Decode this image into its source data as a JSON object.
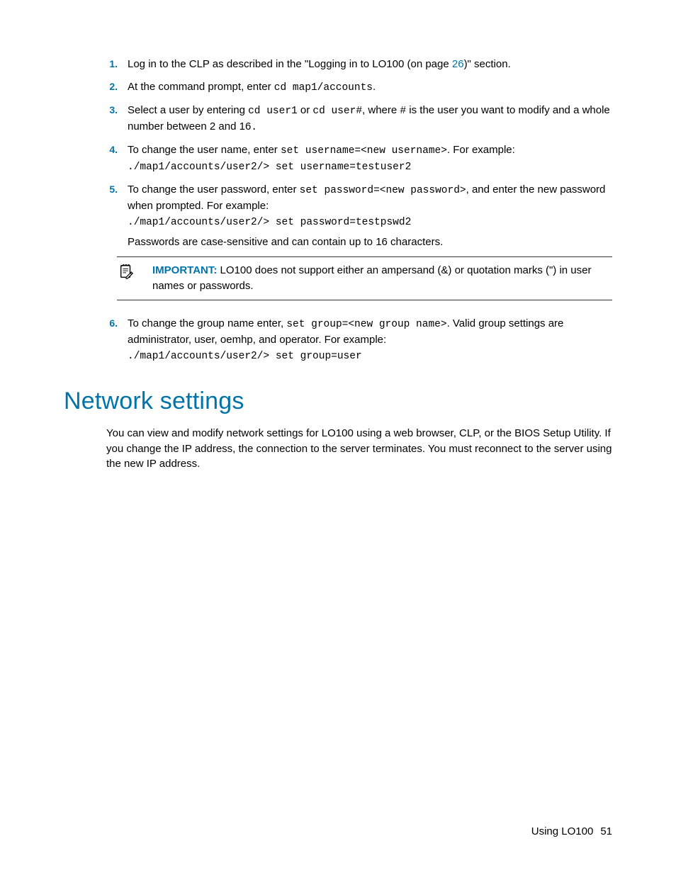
{
  "list": {
    "items": [
      {
        "num": "1.",
        "parts": [
          {
            "t": "Log in to the CLP as described in the \"Logging in to LO100 (on page "
          },
          {
            "t": "26",
            "link": true
          },
          {
            "t": ")\" section."
          }
        ]
      },
      {
        "num": "2.",
        "parts": [
          {
            "t": "At the command prompt, enter "
          },
          {
            "t": "cd map1/accounts",
            "mono": true
          },
          {
            "t": "."
          }
        ]
      },
      {
        "num": "3.",
        "parts": [
          {
            "t": "Select a user by entering "
          },
          {
            "t": "cd user1",
            "mono": true
          },
          {
            "t": " or "
          },
          {
            "t": "cd user#",
            "mono": true
          },
          {
            "t": ", where "
          },
          {
            "t": "#",
            "mono": true
          },
          {
            "t": " is the user you want to modify and a whole number between 2 and 16"
          },
          {
            "t": ".",
            "mono": true
          }
        ]
      },
      {
        "num": "4.",
        "parts": [
          {
            "t": "To change the user name, enter "
          },
          {
            "t": "set username=<new username>",
            "mono": true
          },
          {
            "t": ". For example:"
          }
        ],
        "extra": [
          {
            "t": "./map1/accounts/user2/> set username=testuser2",
            "mono": true
          }
        ]
      },
      {
        "num": "5.",
        "parts": [
          {
            "t": "To change the user password, enter "
          },
          {
            "t": "set password=<new password>",
            "mono": true
          },
          {
            "t": ", and enter the new password when prompted. For example:"
          }
        ],
        "extra": [
          {
            "t": "./map1/accounts/user2/> set password=testpswd2",
            "mono": true
          }
        ],
        "after": "Passwords are case-sensitive and can contain up to 16 characters."
      },
      {
        "num": "6.",
        "parts": [
          {
            "t": "To change the group name enter, "
          },
          {
            "t": "set group=<new group name>",
            "mono": true
          },
          {
            "t": ". Valid group settings are administrator, user, oemhp, and operator. For example:"
          }
        ],
        "extra": [
          {
            "t": "./map1/accounts/user2/> set group=user",
            "mono": true
          }
        ]
      }
    ]
  },
  "important": {
    "label": "IMPORTANT:",
    "text": " LO100 does not support either an ampersand (&) or quotation marks (\") in user names or passwords."
  },
  "section": {
    "heading": "Network settings",
    "body": "You can view and modify network settings for LO100 using a web browser, CLP, or the BIOS Setup Utility. If you change the IP address, the connection to the server terminates. You must reconnect to the server using the new IP address."
  },
  "footer": {
    "text": "Using LO100",
    "page": "51"
  }
}
